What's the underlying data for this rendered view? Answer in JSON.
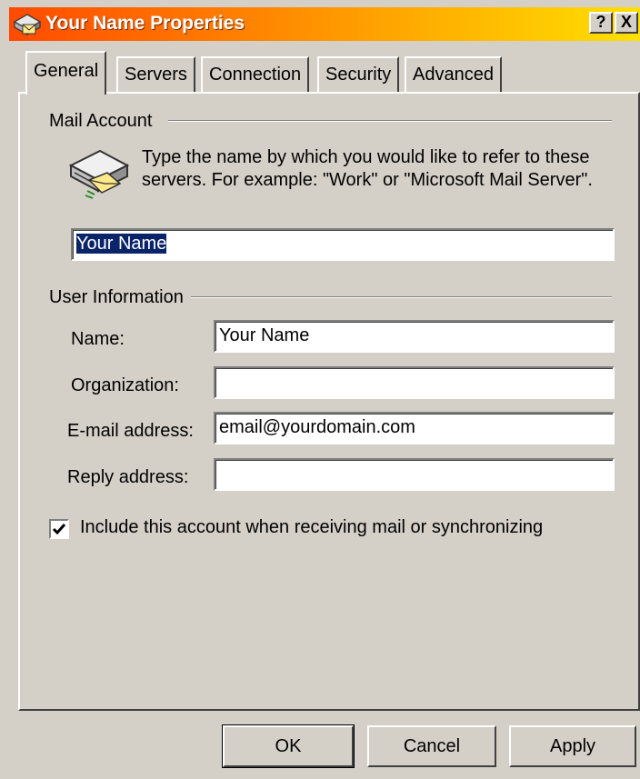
{
  "window": {
    "title": "Your Name Properties",
    "help_label": "?",
    "close_label": "X"
  },
  "tabs": [
    {
      "label": "General",
      "active": true
    },
    {
      "label": "Servers",
      "active": false
    },
    {
      "label": "Connection",
      "active": false
    },
    {
      "label": "Security",
      "active": false
    },
    {
      "label": "Advanced",
      "active": false
    }
  ],
  "mail_account": {
    "heading": "Mail Account",
    "description": "Type the name by which you would like to refer to these servers.  For example: \"Work\" or \"Microsoft Mail Server\".",
    "account_name_value": "Your Name"
  },
  "user_info": {
    "heading": "User Information",
    "name_label": "Name:",
    "name_value": "Your Name",
    "organization_label": "Organization:",
    "organization_value": "",
    "email_label": "E-mail address:",
    "email_value": "email@yourdomain.com",
    "reply_label": "Reply address:",
    "reply_value": ""
  },
  "include_account": {
    "label": "Include this account when receiving mail or synchronizing",
    "checked": true
  },
  "buttons": {
    "ok": "OK",
    "cancel": "Cancel",
    "apply": "Apply"
  }
}
